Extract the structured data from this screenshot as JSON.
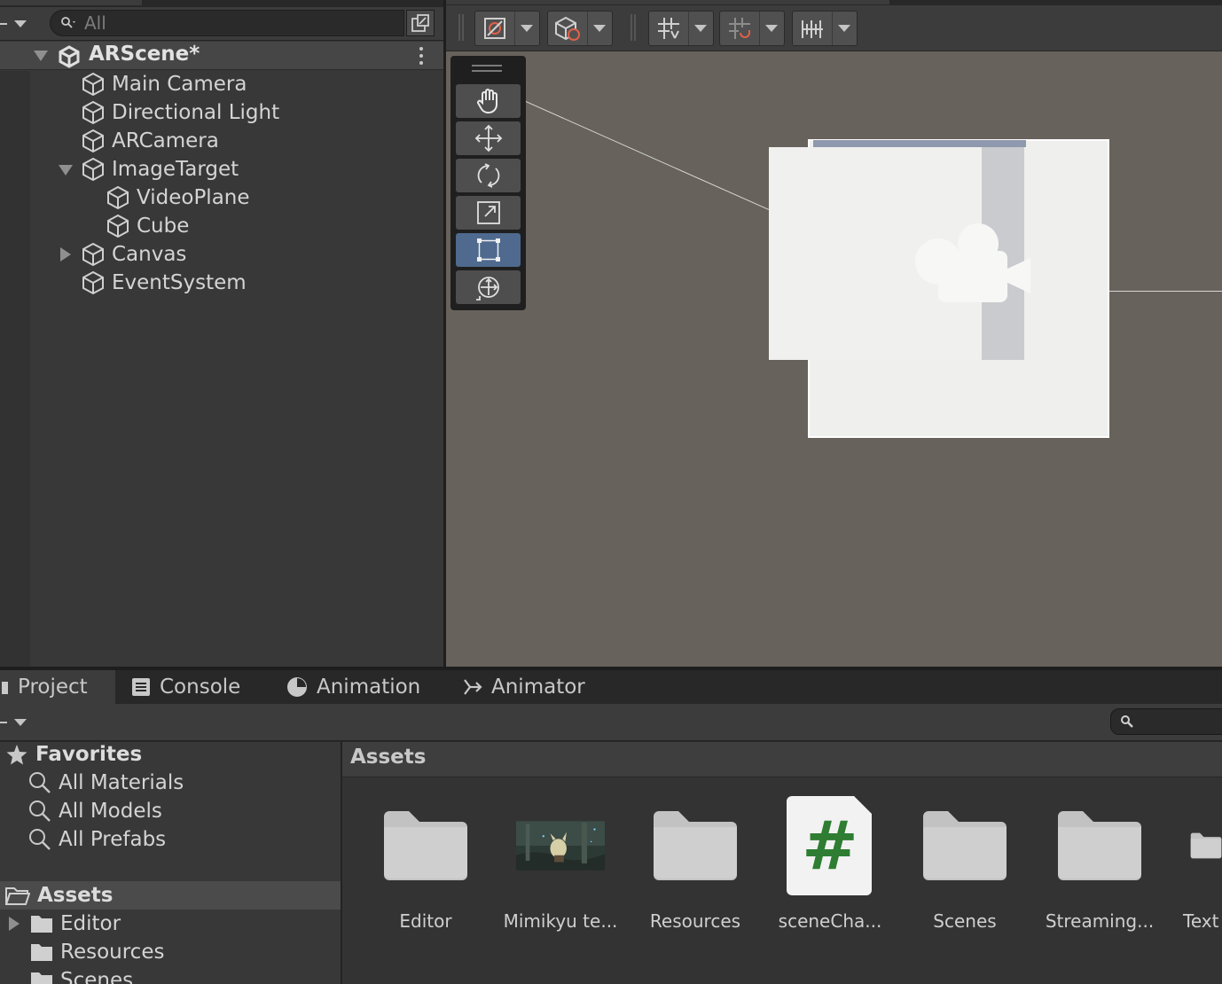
{
  "hierarchy": {
    "search_placeholder": "All",
    "scene_name": "ARScene*",
    "items": [
      {
        "label": "Main Camera"
      },
      {
        "label": "Directional Light"
      },
      {
        "label": "ARCamera"
      },
      {
        "label": "ImageTarget"
      },
      {
        "label": "VideoPlane"
      },
      {
        "label": "Cube"
      },
      {
        "label": "Canvas"
      },
      {
        "label": "EventSystem"
      }
    ]
  },
  "scene_view": {
    "toolbar": [
      "draw-mode-icon",
      "gizmo-render-icon",
      "grid-snap-icon",
      "increment-snap-icon",
      "ruler-icon"
    ],
    "tools": [
      "hand-tool-icon",
      "move-tool-icon",
      "rotate-tool-icon",
      "scale-tool-icon",
      "rect-tool-icon",
      "transform-tool-icon"
    ],
    "active_tool": "rect-tool-icon"
  },
  "bottom_tabs": [
    {
      "label": "Project",
      "icon": "folder-icon",
      "active": true
    },
    {
      "label": "Console",
      "icon": "console-icon"
    },
    {
      "label": "Animation",
      "icon": "clock-icon"
    },
    {
      "label": "Animator",
      "icon": "animator-icon"
    }
  ],
  "project": {
    "favorites": {
      "title": "Favorites",
      "items": [
        {
          "label": "All Materials"
        },
        {
          "label": "All Models"
        },
        {
          "label": "All Prefabs"
        }
      ]
    },
    "assets_tree": {
      "title": "Assets",
      "items": [
        {
          "label": "Editor"
        },
        {
          "label": "Resources"
        },
        {
          "label": "Scenes"
        }
      ]
    },
    "breadcrumb": "Assets",
    "grid": [
      {
        "label": "Editor",
        "type": "folder"
      },
      {
        "label": "Mimikyu te...",
        "type": "video"
      },
      {
        "label": "Resources",
        "type": "folder"
      },
      {
        "label": "sceneCha...",
        "type": "script"
      },
      {
        "label": "Scenes",
        "type": "folder"
      },
      {
        "label": "Streaming...",
        "type": "folder"
      },
      {
        "label": "Text",
        "type": "folder"
      }
    ],
    "script_glyph": "#",
    "colors": {
      "script_hash": "#2e7d32",
      "selection": "#4f6a8e",
      "scene_bg": "#67625b"
    }
  }
}
